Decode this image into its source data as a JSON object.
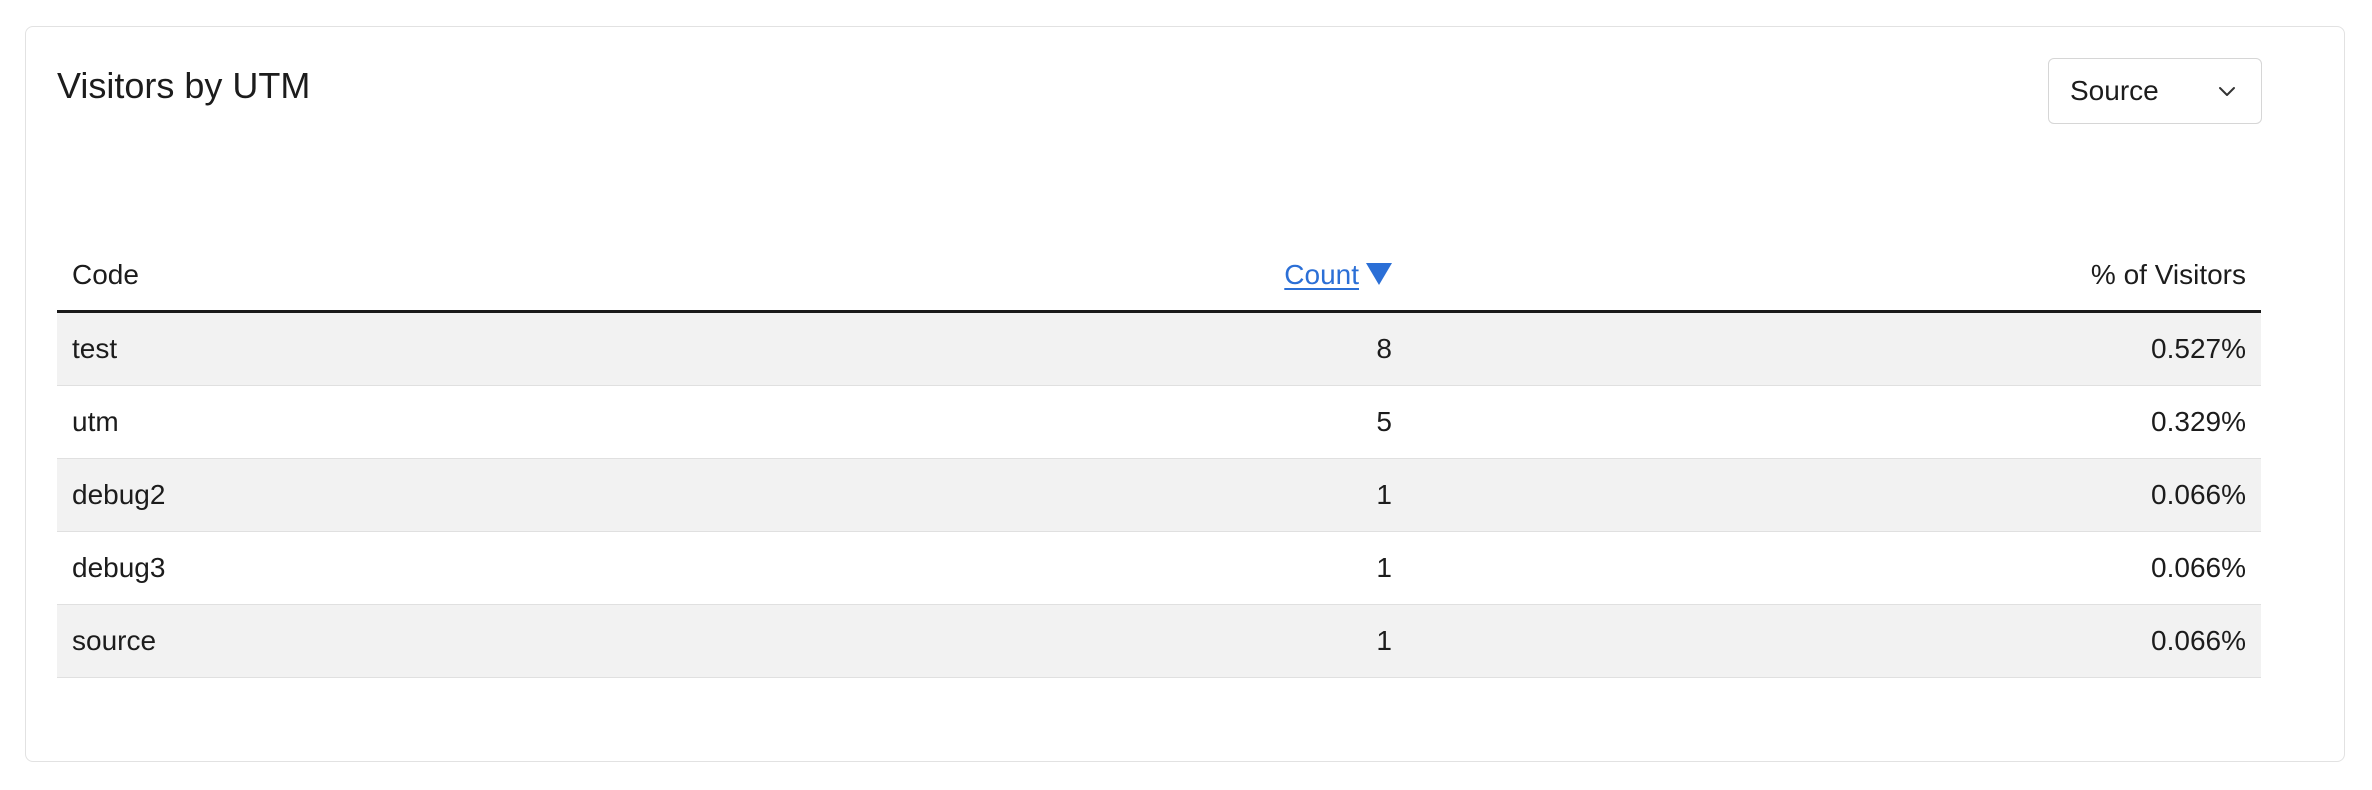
{
  "card": {
    "title": "Visitors by UTM"
  },
  "filter": {
    "selected": "Source",
    "icon": "chevron-down-icon"
  },
  "table": {
    "columns": {
      "code": "Code",
      "count": "Count",
      "pct": "% of Visitors"
    },
    "sort": {
      "column": "count",
      "direction": "desc",
      "icon": "sort-desc-triangle-icon"
    },
    "rows": [
      {
        "code": "test",
        "count": "8",
        "pct": "0.527%"
      },
      {
        "code": "utm",
        "count": "5",
        "pct": "0.329%"
      },
      {
        "code": "debug2",
        "count": "1",
        "pct": "0.066%"
      },
      {
        "code": "debug3",
        "count": "1",
        "pct": "0.066%"
      },
      {
        "code": "source",
        "count": "1",
        "pct": "0.066%"
      }
    ]
  },
  "colors": {
    "link": "#2b6fd6",
    "row_stripe": "#f2f2f2",
    "border": "#e2e2e2"
  }
}
